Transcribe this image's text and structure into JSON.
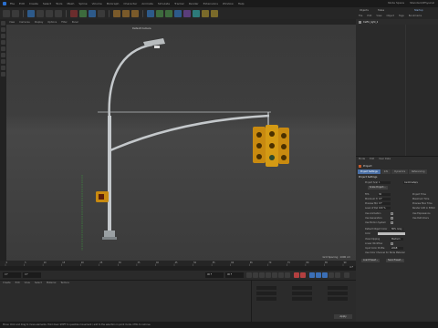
{
  "menubar": {
    "items": [
      "File",
      "Edit",
      "Create",
      "Select",
      "Tools",
      "Mesh",
      "Spline",
      "Volume",
      "MoGraph",
      "Character",
      "Animate",
      "Simulate",
      "Tracker",
      "Render",
      "Extensions",
      "Window",
      "Help"
    ],
    "right": [
      "Node Space",
      "Standard/Physical",
      "Layout",
      "Startup"
    ]
  },
  "right_tabs": [
    "Objects",
    "Takes"
  ],
  "object_manager": {
    "menu": [
      "File",
      "Edit",
      "View",
      "Object",
      "Tags",
      "Bookmarks"
    ],
    "object_name": "traffic_light_2"
  },
  "viewport": {
    "menu": [
      "View",
      "Cameras",
      "Display",
      "Options",
      "Filter",
      "Panel"
    ],
    "camera_label": "Default Camera",
    "grid_spacing": "Grid Spacing : 1000 cm"
  },
  "attributes": {
    "menu": [
      "Mode",
      "Edit",
      "User Data"
    ],
    "title": "Project",
    "tabs": [
      {
        "label": "Project Settings",
        "active": true
      },
      {
        "label": "Info",
        "active": false
      },
      {
        "label": "Dynamics",
        "active": false
      },
      {
        "label": "Referencing",
        "active": false
      }
    ],
    "section": "Project Settings",
    "rows": [
      {
        "label": "Project Scale",
        "value": "1",
        "unit": "Centimeters"
      },
      {
        "label": "Scale Project...",
        "button": true
      },
      {
        "label": "FPS",
        "value": "30",
        "label2": "Project Time",
        "value2": "0 F"
      },
      {
        "label": "Minimum Time",
        "value": "0 F",
        "label2": "Maximum Time",
        "value2": "90 F"
      },
      {
        "label": "Preview Min Time",
        "value": "0 F",
        "label2": "Preview Max Time",
        "value2": "90 F"
      },
      {
        "label": "Level of Detail",
        "value": "100 %",
        "label2": "Render LOD in Editor",
        "value2": ""
      },
      {
        "label": "Use Animation",
        "check": true,
        "label2": "Use Expressions",
        "value2": ""
      },
      {
        "label": "Use Generators",
        "check": true,
        "label2": "Use Deformers",
        "value2": ""
      },
      {
        "label": "Use Motion System",
        "check": true
      }
    ],
    "extra_rows": [
      {
        "label": "Default Object Color",
        "value": "80% Gray"
      },
      {
        "label": "Color",
        "value": ""
      },
      {
        "label": "View Clipping",
        "value": "Medium"
      },
      {
        "label": "Linear Workflow",
        "value": ""
      },
      {
        "label": "Input Color Profile",
        "value": "sRGB"
      },
      {
        "label": "Use Color Channel for Node Material",
        "value": ""
      }
    ],
    "buttons": [
      "Load Preset...",
      "Save Preset..."
    ]
  },
  "timeline": {
    "ticks": [
      "0",
      "5",
      "10",
      "15",
      "20",
      "25",
      "30",
      "35",
      "40",
      "45",
      "50",
      "55",
      "60",
      "65",
      "70",
      "75",
      "80",
      "85",
      "90"
    ],
    "end_label": "0 F"
  },
  "transport": {
    "current": "0 F",
    "start": "0 F",
    "end": "90 F",
    "end2": "90 F"
  },
  "materials": {
    "menu": [
      "Create",
      "Edit",
      "View",
      "Select",
      "Material",
      "Texture"
    ]
  },
  "coordinates": {
    "apply_label": "Apply"
  },
  "status": "Move: Click and drag to move elements. Hold down SHIFT to quantize movement / add to the selection in point mode, CTRL to remove."
}
